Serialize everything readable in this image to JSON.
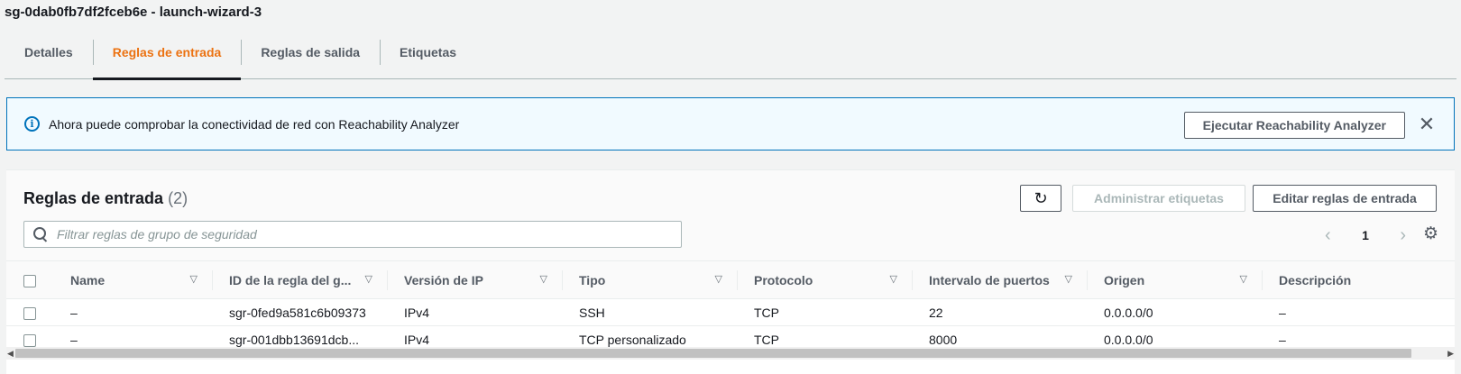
{
  "page": {
    "title": "sg-0dab0fb7df2fceb6e - launch-wizard-3"
  },
  "tabs": [
    {
      "label": "Detalles"
    },
    {
      "label": "Reglas de entrada"
    },
    {
      "label": "Reglas de salida"
    },
    {
      "label": "Etiquetas"
    }
  ],
  "flash": {
    "icon": "info-icon",
    "message": "Ahora puede comprobar la conectividad de red con Reachability Analyzer",
    "button_label": "Ejecutar Reachability Analyzer",
    "close_icon": "close-icon"
  },
  "panel": {
    "title": "Reglas de entrada",
    "count": "(2)",
    "refresh_icon": "refresh-icon",
    "admin_tags_label": "Administrar etiquetas",
    "edit_rules_label": "Editar reglas de entrada",
    "search_placeholder": "Filtrar reglas de grupo de seguridad",
    "page_number": "1",
    "settings_icon": "gear-icon"
  },
  "table": {
    "columns": [
      "Name",
      "ID de la regla del g...",
      "Versión de IP",
      "Tipo",
      "Protocolo",
      "Intervalo de puertos",
      "Origen",
      "Descripción"
    ],
    "rows": [
      [
        "–",
        "sgr-0fed9a581c6b09373",
        "IPv4",
        "SSH",
        "TCP",
        "22",
        "0.0.0.0/0",
        "–"
      ],
      [
        "–",
        "sgr-001dbb13691dcb...",
        "IPv4",
        "TCP personalizado",
        "TCP",
        "8000",
        "0.0.0.0/0",
        "–"
      ]
    ]
  },
  "colors": {
    "accent": "#ec7211",
    "info": "#0073bb"
  }
}
